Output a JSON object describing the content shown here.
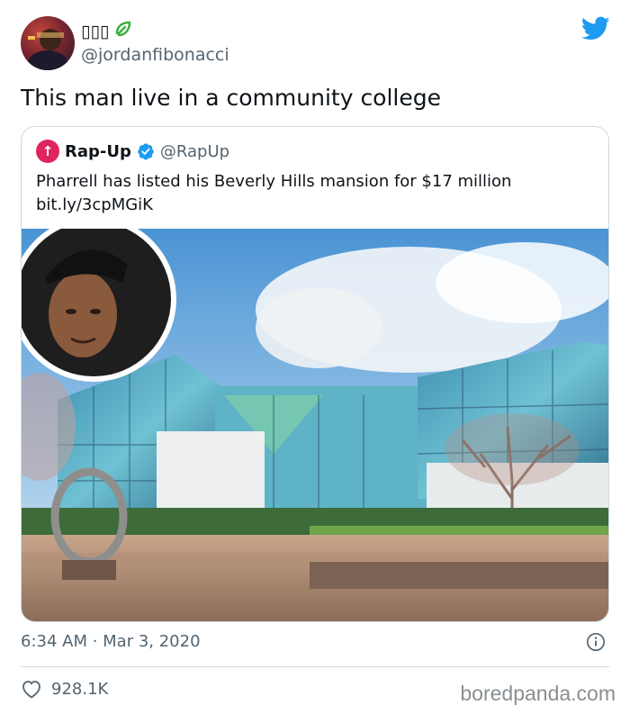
{
  "author": {
    "display_name": "▯▯▯",
    "handle": "@jordanfibonacci"
  },
  "tweet": {
    "text": "This man live in a community college",
    "timestamp": "6:34 AM · Mar 3, 2020",
    "like_count": "928.1K"
  },
  "quoted_tweet": {
    "display_name": "Rap-Up",
    "handle": "@RapUp",
    "text_line1": "Pharrell has listed his Beverly Hills mansion for $17 million",
    "text_line2": "bit.ly/3cpMGiK"
  },
  "watermark": "boredpanda.com",
  "icons": {
    "brand": "twitter-bird-icon",
    "verified": "verified-badge-icon",
    "like": "heart-icon",
    "info": "info-icon"
  },
  "colors": {
    "twitter_blue": "#1d9bf0",
    "secondary_text": "#536471",
    "border": "#cfd9de",
    "rapup_red": "#e0245e"
  }
}
